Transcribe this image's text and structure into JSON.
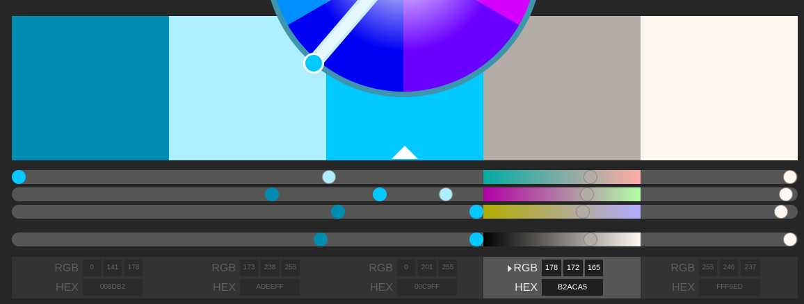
{
  "swatches": [
    {
      "hex_label": "008DB2",
      "r": "0",
      "g": "141",
      "b": "178",
      "color": "#008DB2",
      "ch_pos": [
        0,
        0.553,
        0.698
      ],
      "b_pos": 0.66
    },
    {
      "hex_label": "ADEEFF",
      "r": "173",
      "g": "238",
      "b": "255",
      "color": "#ADEEFF",
      "ch_pos": [
        0.678,
        0.933,
        1.0
      ],
      "b_pos": 1.0
    },
    {
      "hex_label": "00C9FF",
      "r": "0",
      "g": "201",
      "b": "255",
      "color": "#00C9FF",
      "ch_pos": [
        0,
        0.788,
        1.0
      ],
      "b_pos": 1.0
    },
    {
      "hex_label": "B2ACA5",
      "r": "178",
      "g": "172",
      "b": "165",
      "color": "#B2ACA5",
      "ch_pos": [
        0.698,
        0.675,
        0.647
      ],
      "b_pos": 0.698
    },
    {
      "hex_label": "FFF6ED",
      "r": "255",
      "g": "246",
      "b": "237",
      "color": "#FFF6ED",
      "ch_pos": [
        1.0,
        0.965,
        0.929
      ],
      "b_pos": 1.0
    }
  ],
  "selected_index": 3,
  "active_swatch_index": 2,
  "labels": {
    "rgb": "RGB",
    "hex": "HEX"
  },
  "icons": {
    "expand": "caret-right-icon",
    "base": "triangle-up-icon",
    "wheel_handle": "color-handle-icon"
  },
  "colors": {
    "background": "#262626",
    "track": "#565656",
    "panel": "#333333",
    "panel_active": "#575757"
  }
}
